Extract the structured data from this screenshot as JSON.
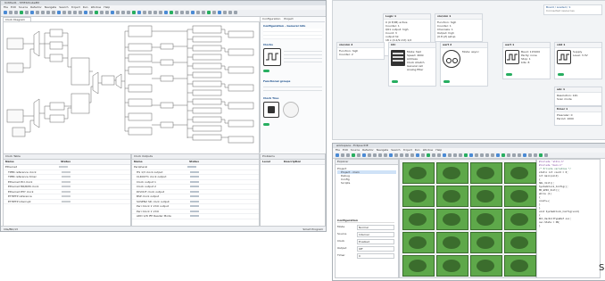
{
  "left_window": {
    "title": "Untitled1 - STM32CubeMX",
    "menu": [
      "File",
      "Edit",
      "Source",
      "Refactor",
      "Navigate",
      "Search",
      "Project",
      "Run",
      "Window",
      "Help"
    ],
    "editor_tab": "Clock Diagram",
    "right_tabs": [
      "Configuration",
      "Project"
    ],
    "right_sections": [
      "Configuration - General Info",
      "Clocks",
      "Functional groups",
      "Clock Tree"
    ],
    "bottom_left": {
      "tab": "Clock Table",
      "columns": [
        "Name",
        "Status"
      ],
      "rows": [
        "Ethernet",
        "TPER reference clock",
        "TPER reference timer",
        "Ethernet PCI clock",
        "Ethernet MII/RMII clock",
        "Ethernet PHY clock",
        "ETHPTP reference",
        "ETHPTP interrupt"
      ]
    },
    "bottom_mid": {
      "tab": "Clock Outputs",
      "columns": [
        "Name",
        "Status"
      ],
      "rows": [
        "Peripheral",
        "HS 1/3 clock output",
        "CLKOUT1 clock output",
        "Clock output 1",
        "Clock output 2",
        "DIVOUT clock output",
        "BSP clock output",
        "SUSEN2 SD clock output",
        "Peri Clock 1 VCO output",
        "Peri Clock 1 VCO",
        "ADD 1/N IFP Reader Mode"
      ]
    },
    "bottom_right": {
      "tab": "Problems",
      "columns": [
        "Level",
        "Description"
      ]
    },
    "status_left": "Idle/Blk/13",
    "status_right": "Smart Program"
  },
  "top_right_window": {
    "cards": [
      {
        "title": "Logic 1",
        "lines": [
          "0 (0 E/IM) active",
          "Counter: 1",
          "Q01 output: high",
          "Count: 3",
          "output hz:",
          "18 x (0.2/9 mit) 1/2"
        ]
      },
      {
        "title": "vio/vim 1",
        "lines": [
          "Function: high",
          "Counter: 1",
          "Channels: 1",
          "Output: high",
          "(0.8 pf) setup"
        ]
      },
      {
        "title": "uart 1",
        "lines": [
          "Baud: 115200",
          "Parity: none",
          "Stop: 1",
          "bits: 8"
        ]
      },
      {
        "title": "vdd 1",
        "lines": [
          "Supply",
          "Level: 3.3V"
        ]
      },
      {
        "title": "vio/vim 2",
        "lines": [
          "Function: high",
          "Counter: 2"
        ]
      },
      {
        "title": "I2C",
        "lines": [
          "Mode: fast",
          "Speed: 400k",
          "Address",
          "Clock stretch",
          "General call",
          "Analog filter"
        ]
      },
      {
        "title": "uart 2",
        "lines": [
          "Mode: async"
        ]
      },
      {
        "title": "adc 1",
        "lines": [
          "Resolution: 12b",
          "Scan mode"
        ]
      },
      {
        "title": "timer 1",
        "lines": [
          "Prescaler: 0",
          "Period: 1000"
        ]
      }
    ],
    "header_link": "Board / Loaded / 1",
    "header_sub": "Connected resources"
  },
  "bottom_right_window": {
    "title": "workspace - Eclipse IDE",
    "menu": [
      "File",
      "Edit",
      "Source",
      "Refactor",
      "Navigate",
      "Search",
      "Project",
      "Run",
      "Window",
      "Help"
    ],
    "tab_left": "Explorer",
    "tree": [
      "Project",
      "Project - main",
      "Debug",
      "Config",
      "Scripts"
    ],
    "form_title": "Configuration",
    "form_fields": [
      "Mode",
      "Source",
      "Clock",
      "Output",
      "Timer"
    ],
    "form_values": [
      "Normal",
      "Internal",
      "Enabled",
      "Off",
      "0"
    ],
    "thumbnail_count": 20,
    "code_lines": [
      "#include \"stdio.h\"",
      "#include \"main.h\"",
      "",
      "/* Private variables */",
      "static int count = 0;",
      "",
      "int main(void)",
      "{",
      "  HAL_Init();",
      "  SystemClock_Config();",
      "  MX_GPIO_Init();",
      "  while (1)",
      "  {",
      "    count++;",
      "  }",
      "}",
      "",
      "void SystemClock_Config(void)",
      "{",
      "  RCC_OscInitTypeDef osc;",
      "  osc.State = ON;",
      "}"
    ],
    "bottom_tab": "Problems",
    "side_char": "S"
  },
  "colors": {
    "accent": "#4a8ad4",
    "green": "#27ae60",
    "thumb_green": "#5ea84a"
  }
}
